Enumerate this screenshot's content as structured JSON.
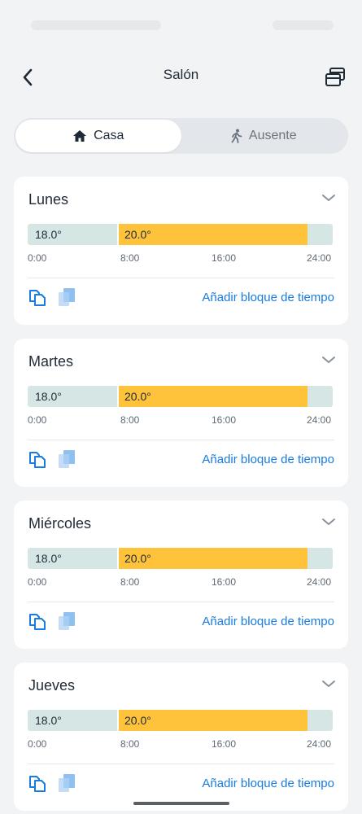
{
  "header": {
    "title": "Salón"
  },
  "mode_toggle": {
    "home_label": "Casa",
    "away_label": "Ausente",
    "selected": "Casa"
  },
  "schedule": {
    "days": [
      {
        "name": "Lunes",
        "blocks": [
          {
            "temp": "18.0°"
          },
          {
            "temp": "20.0°"
          }
        ]
      },
      {
        "name": "Martes",
        "blocks": [
          {
            "temp": "18.0°"
          },
          {
            "temp": "20.0°"
          }
        ]
      },
      {
        "name": "Miércoles",
        "blocks": [
          {
            "temp": "18.0°"
          },
          {
            "temp": "20.0°"
          }
        ]
      },
      {
        "name": "Jueves",
        "blocks": [
          {
            "temp": "18.0°"
          },
          {
            "temp": "20.0°"
          }
        ]
      }
    ],
    "time_ticks": [
      "0:00",
      "8:00",
      "16:00",
      "24:00"
    ],
    "add_block_label": "Añadir bloque de tiempo"
  },
  "icons": {
    "back": "chevron-left-icon",
    "copy_schedule": "copy-schedule-icon",
    "home": "home-icon",
    "away": "walking-person-icon",
    "collapse": "chevron-down-icon",
    "copy_day": "copy-icon",
    "paste_day": "paste-icon"
  },
  "colors": {
    "comfort": "#fec33a",
    "eco": "#d5e6e5",
    "link": "#1a7be0",
    "background": "#f2f3f5"
  }
}
